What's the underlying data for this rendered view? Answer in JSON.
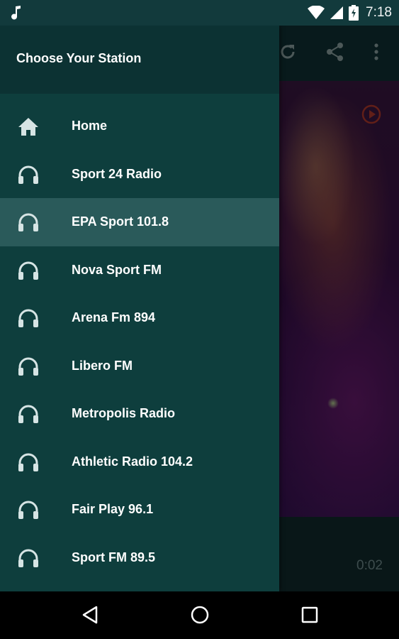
{
  "status_bar": {
    "time": "7:18",
    "icons": [
      "music-note-icon",
      "wifi-icon",
      "signal-icon",
      "battery-icon"
    ]
  },
  "background_app": {
    "toolbar_actions": [
      "refresh-icon",
      "share-icon",
      "more-vert-icon"
    ],
    "elapsed_time": "0:02",
    "accent_color": "#c0392b"
  },
  "drawer": {
    "title": "Choose Your Station",
    "items": [
      {
        "label": "Home",
        "icon": "home-icon",
        "selected": false
      },
      {
        "label": "Sport 24 Radio",
        "icon": "headphones-icon",
        "selected": false
      },
      {
        "label": "EPA Sport 101.8",
        "icon": "headphones-icon",
        "selected": true
      },
      {
        "label": "Nova Sport FM",
        "icon": "headphones-icon",
        "selected": false
      },
      {
        "label": "Arena Fm 894",
        "icon": "headphones-icon",
        "selected": false
      },
      {
        "label": "Libero FM",
        "icon": "headphones-icon",
        "selected": false
      },
      {
        "label": "Metropolis Radio",
        "icon": "headphones-icon",
        "selected": false
      },
      {
        "label": "Athletic Radio 104.2",
        "icon": "headphones-icon",
        "selected": false
      },
      {
        "label": "Fair Play 96.1",
        "icon": "headphones-icon",
        "selected": false
      },
      {
        "label": "Sport FM 89.5",
        "icon": "headphones-icon",
        "selected": false
      }
    ]
  },
  "nav_bar": {
    "buttons": [
      "back-icon",
      "home-circle-icon",
      "recents-icon"
    ]
  },
  "colors": {
    "drawer_bg": "#0e3e3d",
    "selected_item_bg": "#2a5a5a",
    "icon_color": "#d6e4e4"
  }
}
